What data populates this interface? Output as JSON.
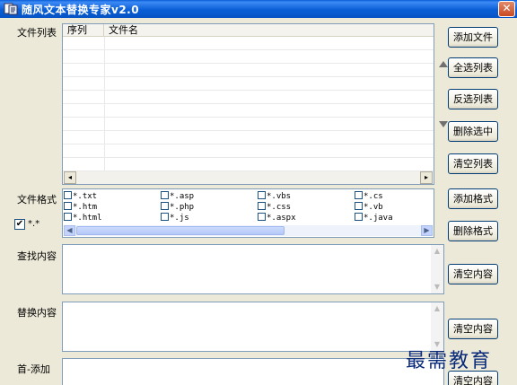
{
  "window": {
    "title": "随风文本替换专家v2.0",
    "close_glyph": "✕"
  },
  "labels": {
    "file_list": "文件列表",
    "file_format": "文件格式",
    "find": "查找内容",
    "replace": "替换内容",
    "prepend": "首-添加"
  },
  "list": {
    "columns": [
      "序列",
      "文件名"
    ],
    "scroll_left": "◂",
    "scroll_right": "▸"
  },
  "buttons": {
    "add_file": "添加文件",
    "select_all": "全选列表",
    "invert": "反选列表",
    "delete_selected": "删除选中",
    "clear_list": "清空列表",
    "add_format": "添加格式",
    "delete_format": "删除格式",
    "clear_find": "清空内容",
    "clear_replace": "清空内容",
    "clear_prepend": "清空内容"
  },
  "formats": [
    "*.txt",
    "*.asp",
    "*.vbs",
    "*.cs",
    "*.htm",
    "*.php",
    "*.css",
    "*.vb",
    "*.html",
    "*.js",
    "*.aspx",
    "*.java"
  ],
  "all_types": {
    "checked": "✔",
    "label": "*.*"
  },
  "format_scroll": {
    "left": "◀",
    "right": "▶"
  },
  "watermark": "最需教育"
}
